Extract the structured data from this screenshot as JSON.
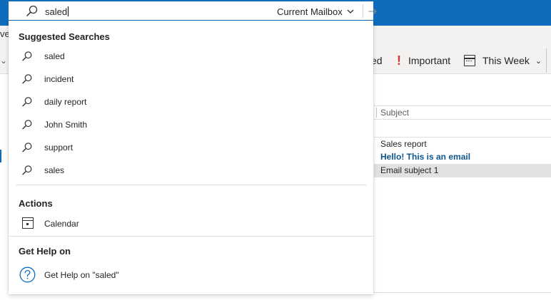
{
  "background": {
    "ribbon_left_text": "vel",
    "ribbon_left_chevron": "⌄",
    "flagged_partial": "ed",
    "important_label": "Important",
    "this_week_label": "This Week",
    "chevron_down": "⌄",
    "subject_header": "Subject",
    "messages": [
      {
        "subject": "Sales report",
        "unread": false,
        "selected": false
      },
      {
        "subject": "Hello! This is an email",
        "unread": true,
        "selected": false
      },
      {
        "subject": "Email subject 1",
        "unread": false,
        "selected": true
      }
    ]
  },
  "search": {
    "query": "saled",
    "scope_label": "Current Mailbox"
  },
  "dropdown": {
    "suggested_title": "Suggested Searches",
    "suggestions": [
      "saled",
      "incident",
      "daily report",
      "John Smith",
      "support",
      "sales"
    ],
    "actions_title": "Actions",
    "actions": [
      {
        "label": "Calendar",
        "icon": "calendar-icon"
      }
    ],
    "help_title": "Get Help on",
    "help_item": "Get Help on \"saled\""
  },
  "colors": {
    "accent": "#0f6cbd",
    "unread_text": "#0f548c",
    "important": "#d13438",
    "selected_row": "#e1e1e1"
  }
}
